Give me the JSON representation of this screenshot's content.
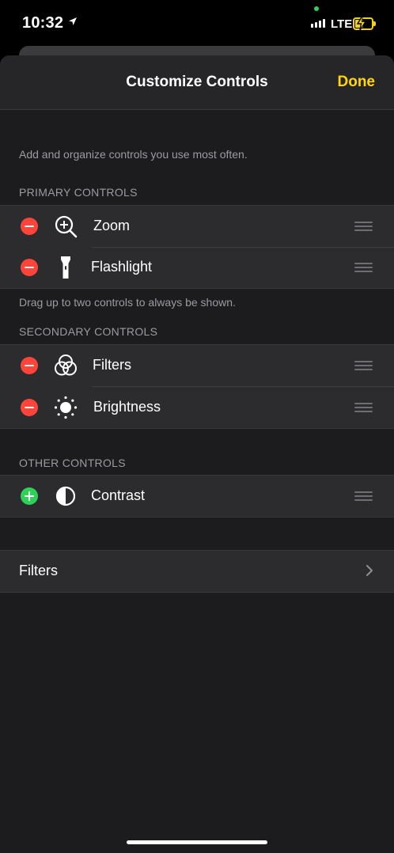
{
  "status": {
    "time": "10:32",
    "network": "LTE",
    "colors": {
      "battery": "#f2d21c",
      "mic_dot": "#2fd158"
    }
  },
  "nav": {
    "title": "Customize Controls",
    "done_label": "Done",
    "done_color": "#ffd60a"
  },
  "intro_note": "Add and organize controls you use most often.",
  "primary": {
    "header": "PRIMARY CONTROLS",
    "items": [
      {
        "label": "Zoom",
        "icon": "zoom-magnifier-icon",
        "action": "remove"
      },
      {
        "label": "Flashlight",
        "icon": "flashlight-icon",
        "action": "remove"
      }
    ],
    "footer": "Drag up to two controls to always be shown."
  },
  "secondary": {
    "header": "SECONDARY CONTROLS",
    "items": [
      {
        "label": "Filters",
        "icon": "filters-circles-icon",
        "action": "remove"
      },
      {
        "label": "Brightness",
        "icon": "brightness-sun-icon",
        "action": "remove"
      }
    ]
  },
  "other": {
    "header": "OTHER CONTROLS",
    "items": [
      {
        "label": "Contrast",
        "icon": "contrast-icon",
        "action": "add"
      }
    ]
  },
  "filters_link": {
    "label": "Filters",
    "icon": "chevron-right-icon"
  },
  "colors": {
    "remove": "#ff453a",
    "add": "#30d158",
    "background": "#1c1c1e",
    "cell": "#2c2c2e"
  }
}
